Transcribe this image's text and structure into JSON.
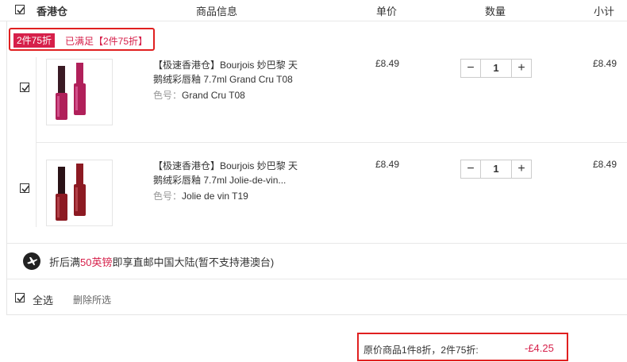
{
  "header": {
    "store_name": "香港仓",
    "col_product": "商品信息",
    "col_price": "单价",
    "col_qty": "数量",
    "col_subtotal": "小计"
  },
  "promo": {
    "badge": "2件75折",
    "status": "已满足【2件75折】"
  },
  "items": [
    {
      "name": "【极速香港仓】Bourjois 妙巴黎 天鹅绒彩唇釉 7.7ml Grand Cru T08",
      "attr_label": "色号：",
      "attr_value": "Grand Cru T08",
      "price": "£8.49",
      "quantity": "1",
      "subtotal": "£8.49",
      "checked": true,
      "color": "#b0205a"
    },
    {
      "name": "【极速香港仓】Bourjois 妙巴黎 天鹅绒彩唇釉 7.7ml Jolie-de-vin...",
      "attr_label": "色号：",
      "attr_value": "Jolie de vin T19",
      "price": "£8.49",
      "quantity": "1",
      "subtotal": "£8.49",
      "checked": true,
      "color": "#8c1a22"
    }
  ],
  "shipping": {
    "prefix": "折后满",
    "amount": "50英镑",
    "suffix": "即享直邮中国大陆(暂不支持港澳台)"
  },
  "footer": {
    "select_all": "全选",
    "delete_selected": "删除所选"
  },
  "summary": {
    "label": "原价商品1件8折，2件75折:",
    "discount": "-£4.25"
  },
  "colors": {
    "accent": "#d6204a",
    "highlight_border": "#e02020"
  }
}
